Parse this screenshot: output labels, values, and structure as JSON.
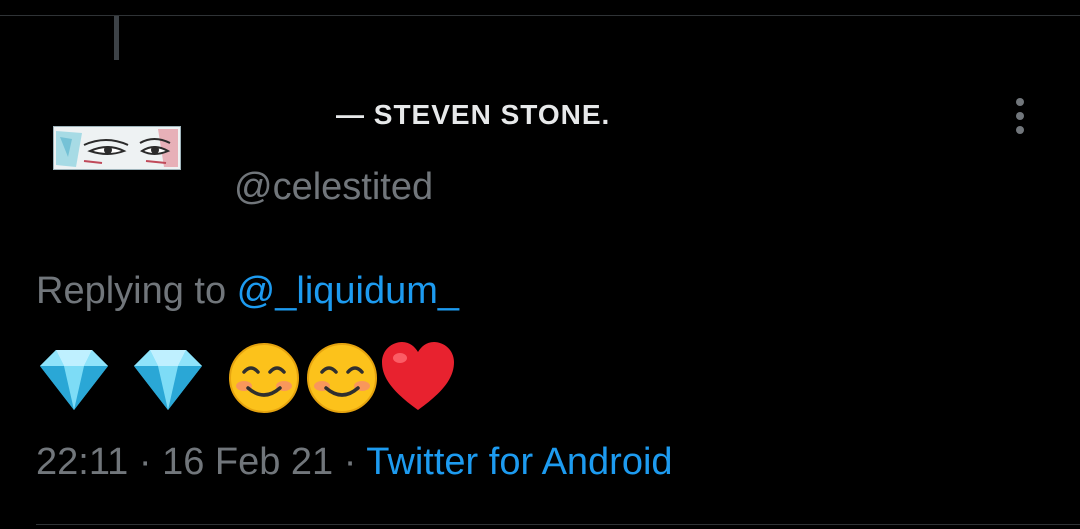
{
  "tweet": {
    "display_name": "— STEVEN STONE.",
    "handle": "@celestited",
    "reply_prefix": "Replying to ",
    "reply_to": "@_liquidum_",
    "emojis": [
      "gem-stone-icon",
      "gem-stone-icon",
      "smiling-face-icon",
      "smiling-face-icon",
      "red-heart-icon"
    ],
    "time": "22:11",
    "separator": " · ",
    "date": "16 Feb 21",
    "source": "Twitter for Android"
  },
  "theme": {
    "background": "#000000",
    "text_primary": "#e7e9ea",
    "text_secondary": "#71767b",
    "link": "#1d9bf0",
    "divider": "#2f3336"
  }
}
